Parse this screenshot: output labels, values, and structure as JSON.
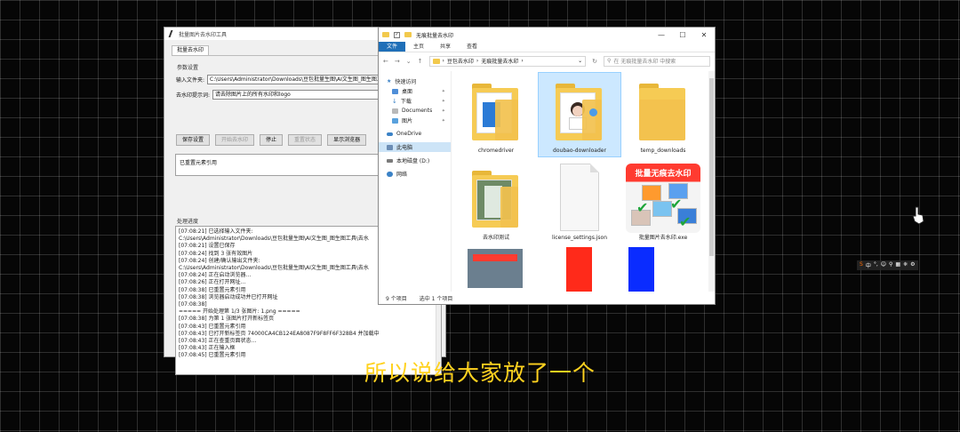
{
  "tool": {
    "title": "批量图片去水印工具",
    "tab": "批量去水印",
    "group_label": "参数设置",
    "input_label": "输入文件夹:",
    "input_value": "C:\\Users\\Administrator\\Downloads\\豆包批量生图\\AI文生图_图生图工具",
    "prompt_label": "去水印提示词:",
    "prompt_value": "请去除图片上的所有水印和logo",
    "buttons": [
      "保存设置",
      "开始去水印",
      "停止",
      "重置状态",
      "显示浏览器"
    ],
    "disabled_buttons": [
      1,
      3
    ],
    "status_text": "已重置元素引用",
    "log_label": "处理进度",
    "log_lines": [
      "[07:08:21] 已选择输入文件夹:",
      "C:\\Users\\Administrator\\Downloads\\豆包批量生图\\AI文生图_图生图工具\\去水",
      "[07:08:21] 设置已保存",
      "[07:08:24] 找到 3 张有效图片",
      "[07:08:24] 创建/确认输出文件夹:",
      "C:\\Users\\Administrator\\Downloads\\豆包批量生图\\AI文生图_图生图工具\\去水",
      "[07:08:24] 正在启动浏览器...",
      "[07:08:26] 正在打开网址...",
      "[07:08:38] 已重置元素引用",
      "[07:08:38] 浏览器启动成功并已打开网址",
      "[07:08:38]",
      "===== 开始处理第 1/3 张图片: 1.png =====",
      "[07:08:38] 为第 1 张图片打开新标签页",
      "[07:08:43] 已重置元素引用",
      "[07:08:43] 已打开新标签页 74000CA4CB124EA8087F9F8FF6F328B4 并加载中",
      "[07:08:43] 正在查重页面状态...",
      "[07:08:43] 正在输入框",
      "[07:08:45] 已重置元素引用"
    ]
  },
  "explorer": {
    "title": "无痕批量去水印",
    "ribbon_tabs": [
      "文件",
      "主页",
      "共享",
      "查看"
    ],
    "breadcrumb": [
      "豆包去水印",
      "无痕批量去水印"
    ],
    "search_placeholder": "在 无痕批量去水印 中搜索",
    "nav": {
      "quick_access": "快速访问",
      "quick_items": [
        "桌面",
        "下载",
        "Documents",
        "图片"
      ],
      "onedrive": "OneDrive",
      "this_pc": "此电脑",
      "local_disk": "本地磁盘 (D:)",
      "network": "网络"
    },
    "files": [
      "chromedriver",
      "doubao-downloader",
      "temp_downloads",
      "去水印测试",
      "license_settings.json",
      "批量图片去水印.exe",
      "",
      "",
      ""
    ],
    "exe_icon_text": "批量无痕去水印",
    "status_count": "9 个项目",
    "status_selected": "选中 1 个项目",
    "win_controls": [
      "—",
      "☐",
      "✕"
    ]
  },
  "subtitle": "所以说给大家放了一个",
  "ime": [
    "S",
    "中",
    "°,",
    "☺",
    "⚲",
    "▦",
    "❈",
    "⚙"
  ],
  "colors": {
    "accent": "#1f6fb8",
    "subtitle": "#ffd21f",
    "red": "#ff2a1a",
    "blue": "#0a2cff"
  }
}
